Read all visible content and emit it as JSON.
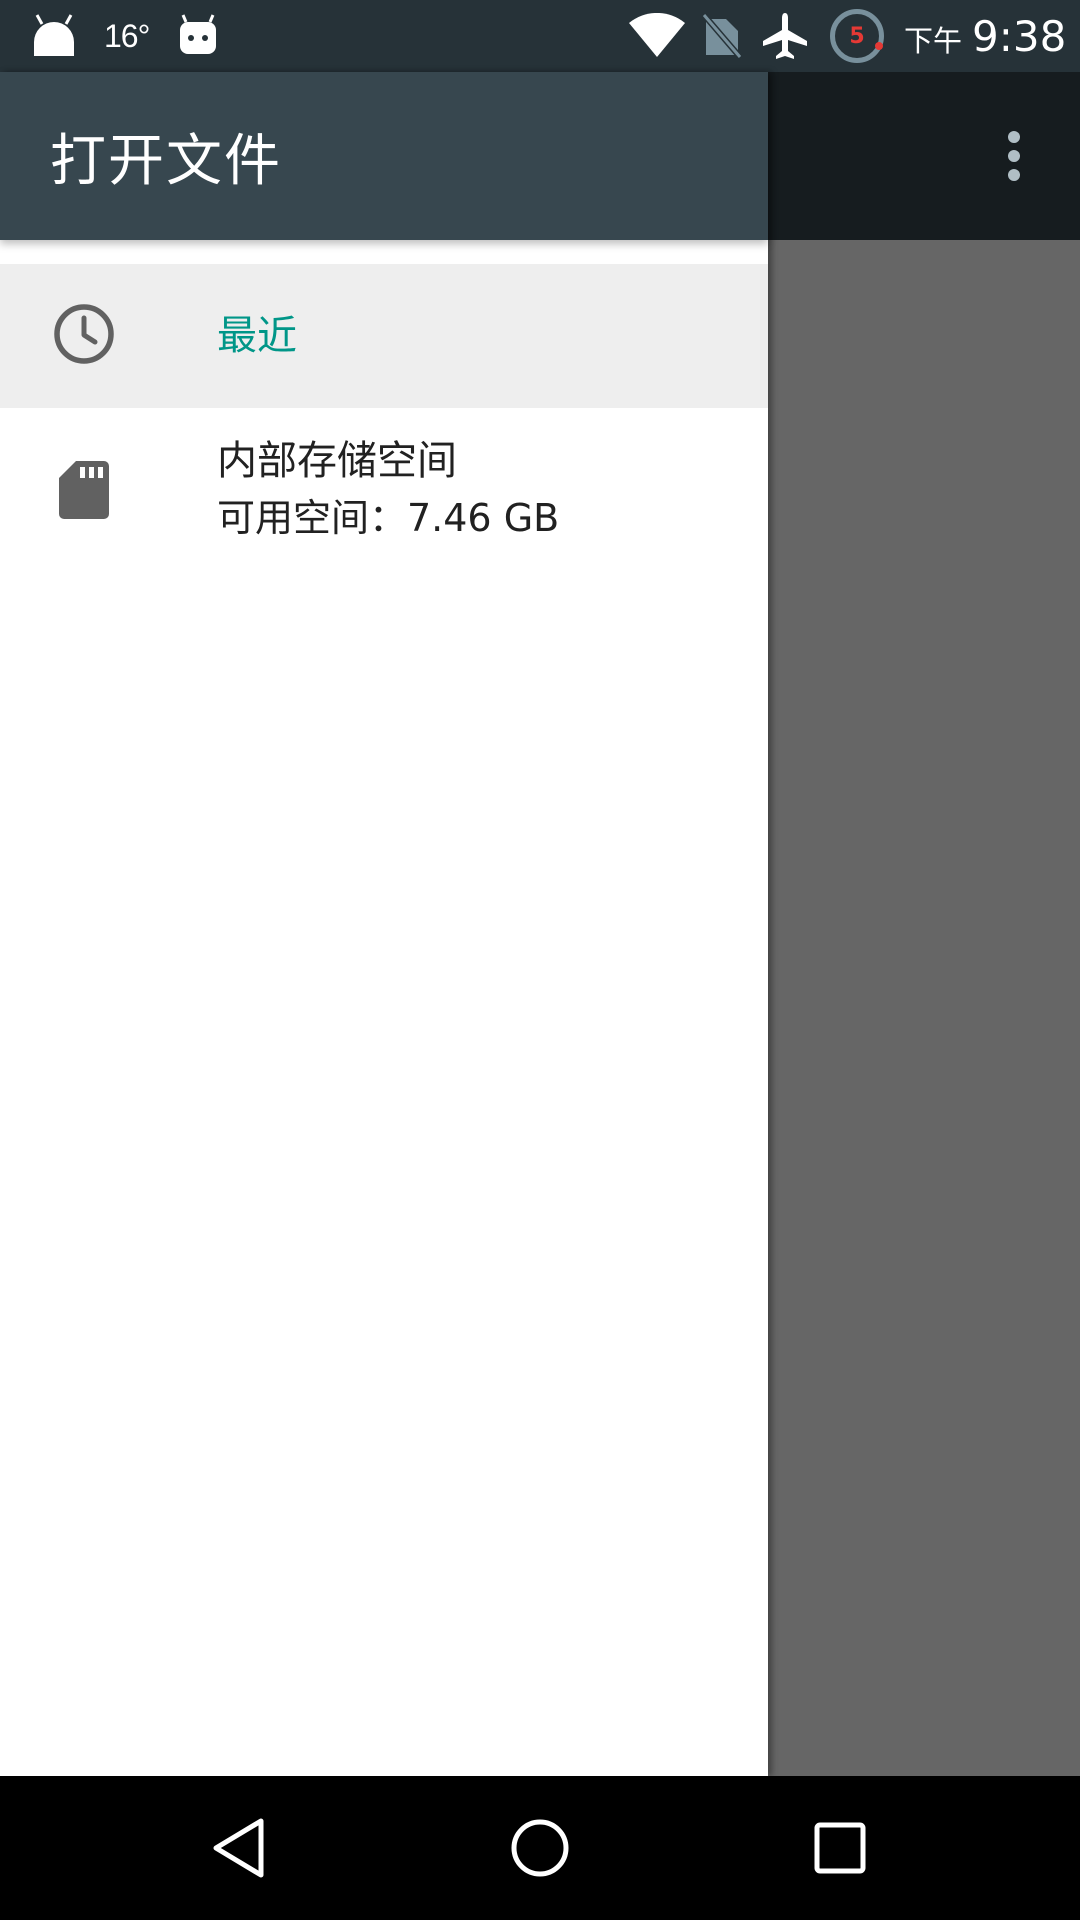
{
  "status_bar": {
    "temperature": "16°",
    "notification_badge": "5",
    "time_period": "下午",
    "time": "9:38",
    "icons": [
      "android-icon",
      "robot-icon",
      "wifi-icon",
      "no-sim-icon",
      "airplane-mode-icon",
      "notification-count-icon"
    ]
  },
  "drawer": {
    "title": "打开文件",
    "roots": [
      {
        "icon": "clock-icon",
        "title": "最近",
        "selected": true
      },
      {
        "icon": "sd-card-icon",
        "title": "内部存储空间",
        "summary": "可用空间：7.46 GB",
        "selected": false
      }
    ]
  },
  "app_bar": {
    "overflow_icon": "more-vert-icon"
  },
  "nav_bar": {
    "icons": [
      "back-icon",
      "home-icon",
      "recents-icon"
    ]
  },
  "colors": {
    "status_bar": "#263238",
    "toolbar": "#37474f",
    "accent": "#009688",
    "selected_row": "#eeeeee"
  }
}
